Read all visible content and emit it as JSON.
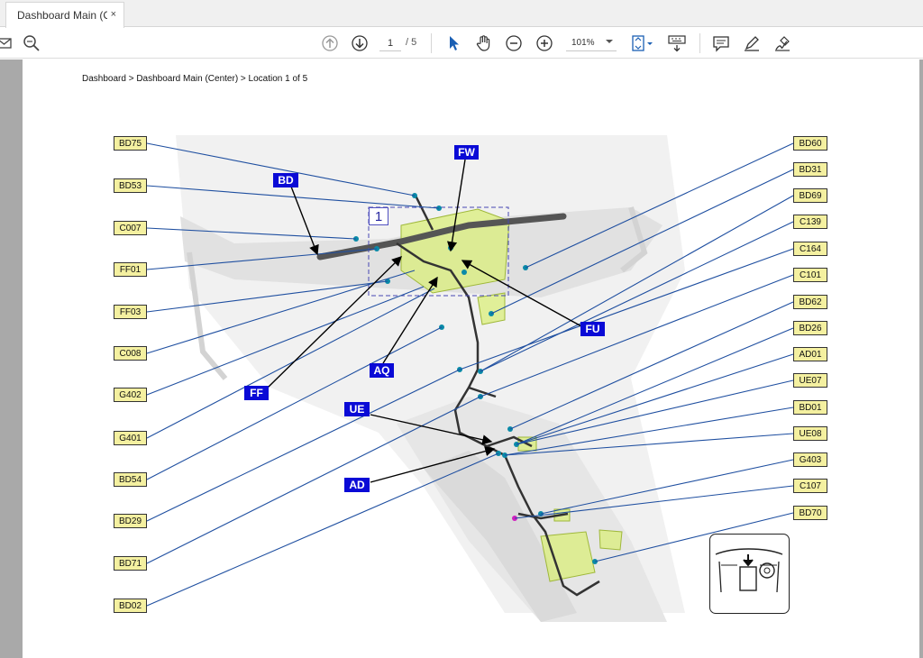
{
  "tab": {
    "title": "Dashboard Main (C...",
    "close": "×"
  },
  "toolbar": {
    "current_page": "1",
    "page_total": "/ 5",
    "zoom": "101%",
    "icons": [
      "mail-icon",
      "zoom-icon",
      "page-up-icon",
      "page-down-icon",
      "pointer-icon",
      "hand-icon",
      "zoom-out-icon",
      "zoom-in-icon",
      "fit-page-icon",
      "keyboard-icon",
      "comment-icon",
      "highlight-icon",
      "sign-icon"
    ]
  },
  "document": {
    "breadcrumb": "Dashboard > Dashboard Main (Center) > Location  1 of 5",
    "callout_number": "1",
    "left_labels": [
      "BD75",
      "BD53",
      "C007",
      "FF01",
      "FF03",
      "C008",
      "G402",
      "G401",
      "BD54",
      "BD29",
      "BD71",
      "BD02"
    ],
    "right_labels": [
      "BD60",
      "BD31",
      "BD69",
      "C139",
      "C164",
      "C101",
      "BD62",
      "BD26",
      "AD01",
      "UE07",
      "BD01",
      "UE08",
      "G403",
      "C107",
      "BD70"
    ],
    "harness_labels": [
      "BD",
      "FW",
      "FF",
      "AQ",
      "FU",
      "UE",
      "AD"
    ],
    "colors": {
      "connector_label_bg": "#f4f0a0",
      "harness_label_bg": "#0a0ad6",
      "leader_line": "#1f4fa0"
    }
  }
}
